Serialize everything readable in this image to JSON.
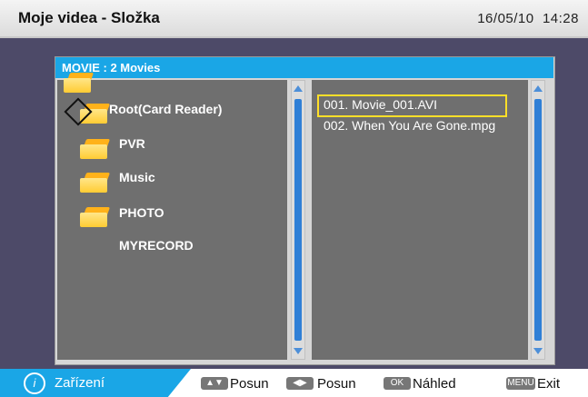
{
  "header": {
    "title": "Moje videa - Složka",
    "date": "16/05/10",
    "time": "14:28"
  },
  "panel": {
    "title": "MOVIE : 2 Movies"
  },
  "folders": [
    {
      "label": "Root(Card Reader)"
    },
    {
      "label": "PVR"
    },
    {
      "label": "Music"
    },
    {
      "label": "PHOTO"
    },
    {
      "label": "MYRECORD"
    }
  ],
  "files": [
    {
      "label": "001.  Movie_001.AVI"
    },
    {
      "label": "002.  When You Are Gone.mpg"
    }
  ],
  "footer": {
    "device_label": "Zařízení",
    "hints": [
      {
        "key": "▲▼",
        "label": "Posun"
      },
      {
        "key": "◀▶",
        "label": "Posun"
      },
      {
        "key": "OK",
        "label": "Náhled"
      },
      {
        "key": "MENU",
        "label": "Exit"
      }
    ]
  },
  "colors": {
    "accent": "#1aa6e6",
    "selection": "#ffdf28",
    "background": "#4d4a68"
  }
}
